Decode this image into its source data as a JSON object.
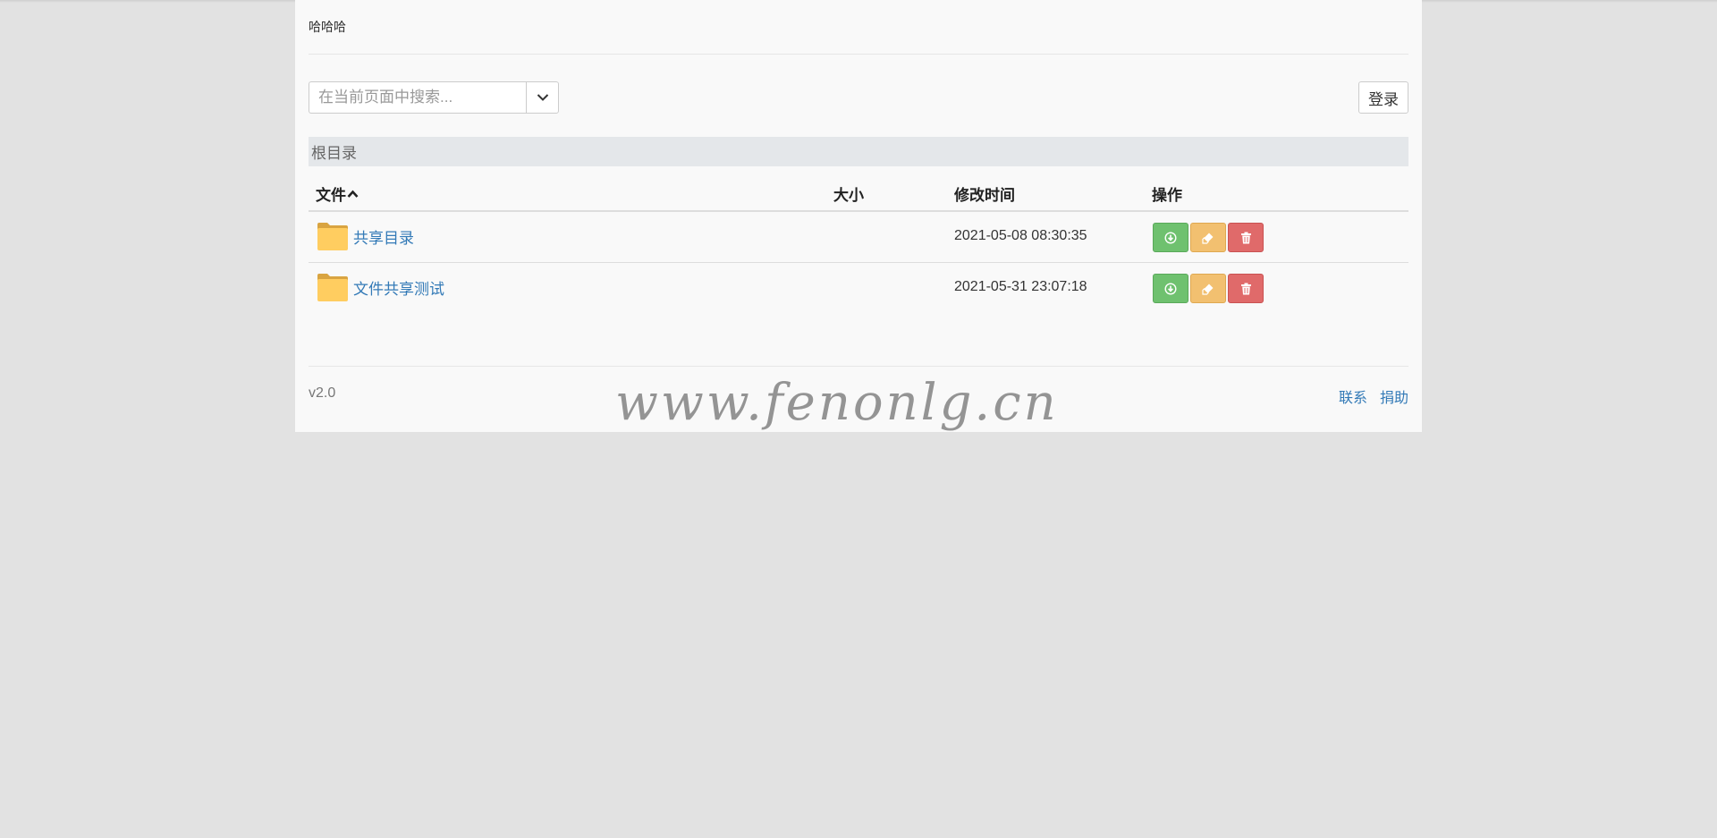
{
  "site": {
    "title": "哈哈哈"
  },
  "search": {
    "placeholder": "在当前页面中搜索...",
    "dropdown_icon": "chevron-down-icon"
  },
  "auth": {
    "login_label": "登录"
  },
  "breadcrumb": {
    "root_label": "根目录"
  },
  "table": {
    "columns": {
      "file": "文件",
      "size": "大小",
      "modified": "修改时间",
      "actions": "操作"
    },
    "sort_icon": "caret-up-icon",
    "rows": [
      {
        "name": "共享目录",
        "size": "",
        "modified": "2021-05-08 08:30:35",
        "icon": "folder-icon"
      },
      {
        "name": "文件共享测试",
        "size": "",
        "modified": "2021-05-31 23:07:18",
        "icon": "folder-icon"
      }
    ],
    "action_icons": [
      "download-icon",
      "rename-icon",
      "trash-icon"
    ]
  },
  "footer": {
    "version": "v2.0",
    "links": [
      "联系",
      "捐助"
    ]
  },
  "watermark": "www.fenonlg.cn",
  "colors": {
    "link": "#337ab7",
    "success": "#6fc16f",
    "warning": "#f2c070",
    "danger": "#e06a6a",
    "folder": "#ffc95c",
    "breadcrumb_bg": "#e4e7ea"
  }
}
